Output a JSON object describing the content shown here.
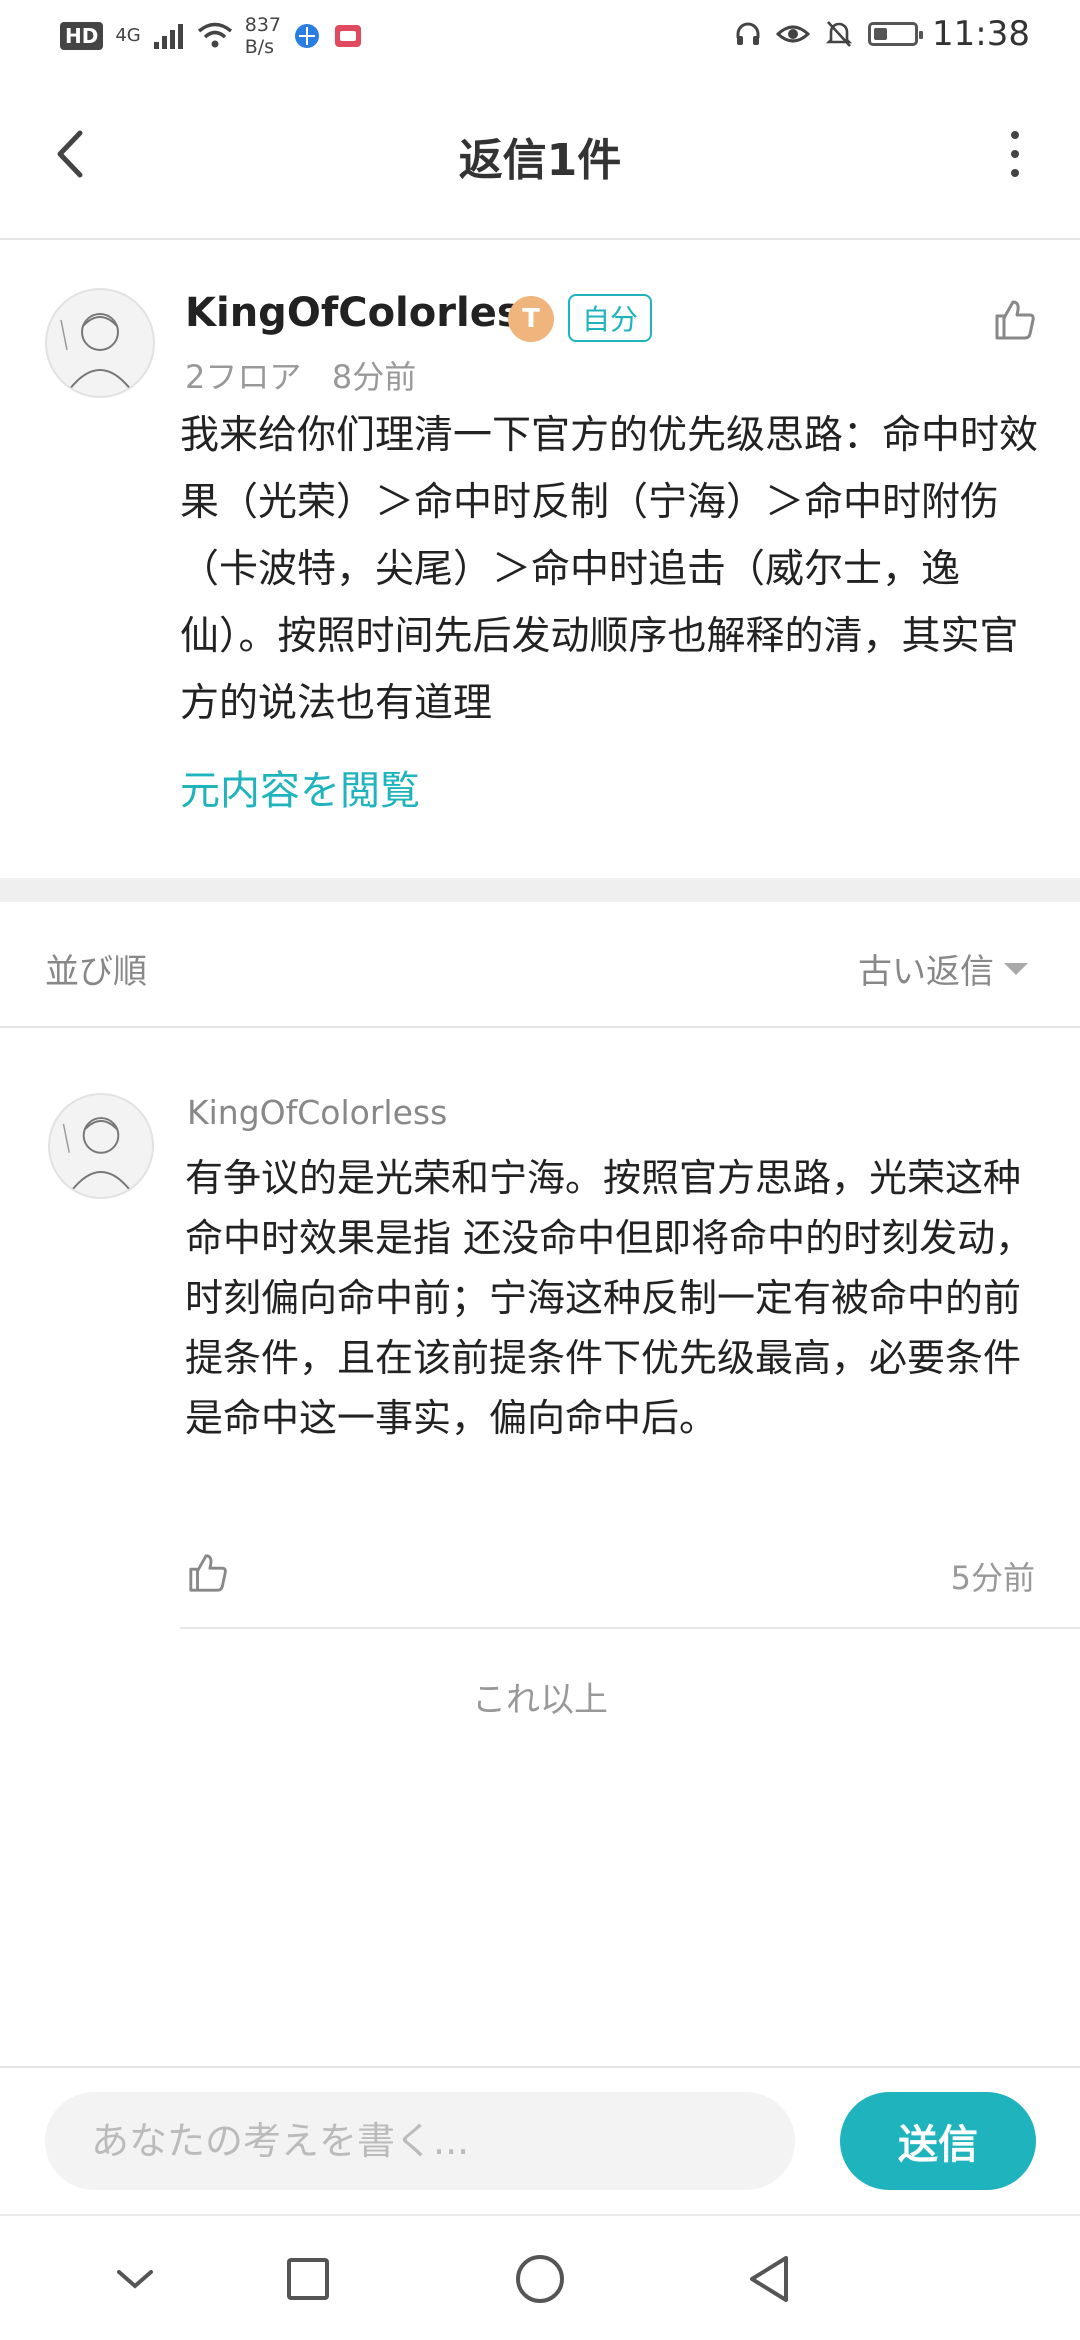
{
  "status_bar": {
    "hd": "HD",
    "network": "4G",
    "speed_value": "837",
    "speed_unit": "B/s",
    "battery_level": 0.35,
    "time": "11:38"
  },
  "header": {
    "title": "返信1件"
  },
  "main_comment": {
    "username": "KingOfColorless",
    "level_badge": "T",
    "self_tag": "自分",
    "floor": "2フロア",
    "time": "8分前",
    "text": "我来给你们理清一下官方的优先级思路：命中时效果（光荣）＞命中时反制（宁海）＞命中时附伤（卡波特，尖尾）＞命中时追击（威尔士，逸仙）。按照时间先后发动顺序也解释的清，其实官方的说法也有道理",
    "view_original": "元内容を閲覧"
  },
  "sort": {
    "label": "並び順",
    "value": "古い返信"
  },
  "reply": {
    "username": "KingOfColorless",
    "text": "有争议的是光荣和宁海。按照官方思路，光荣这种命中时效果是指 还没命中但即将命中的时刻发动，时刻偏向命中前；宁海这种反制一定有被命中的前提条件，且在该前提条件下优先级最高，必要条件是命中这一事实，偏向命中后。",
    "time": "5分前"
  },
  "no_more": "これ以上",
  "input": {
    "placeholder": "あなたの考えを書く...",
    "send_label": "送信"
  },
  "colors": {
    "accent": "#1fb3be",
    "badge": "#f0b57c"
  }
}
